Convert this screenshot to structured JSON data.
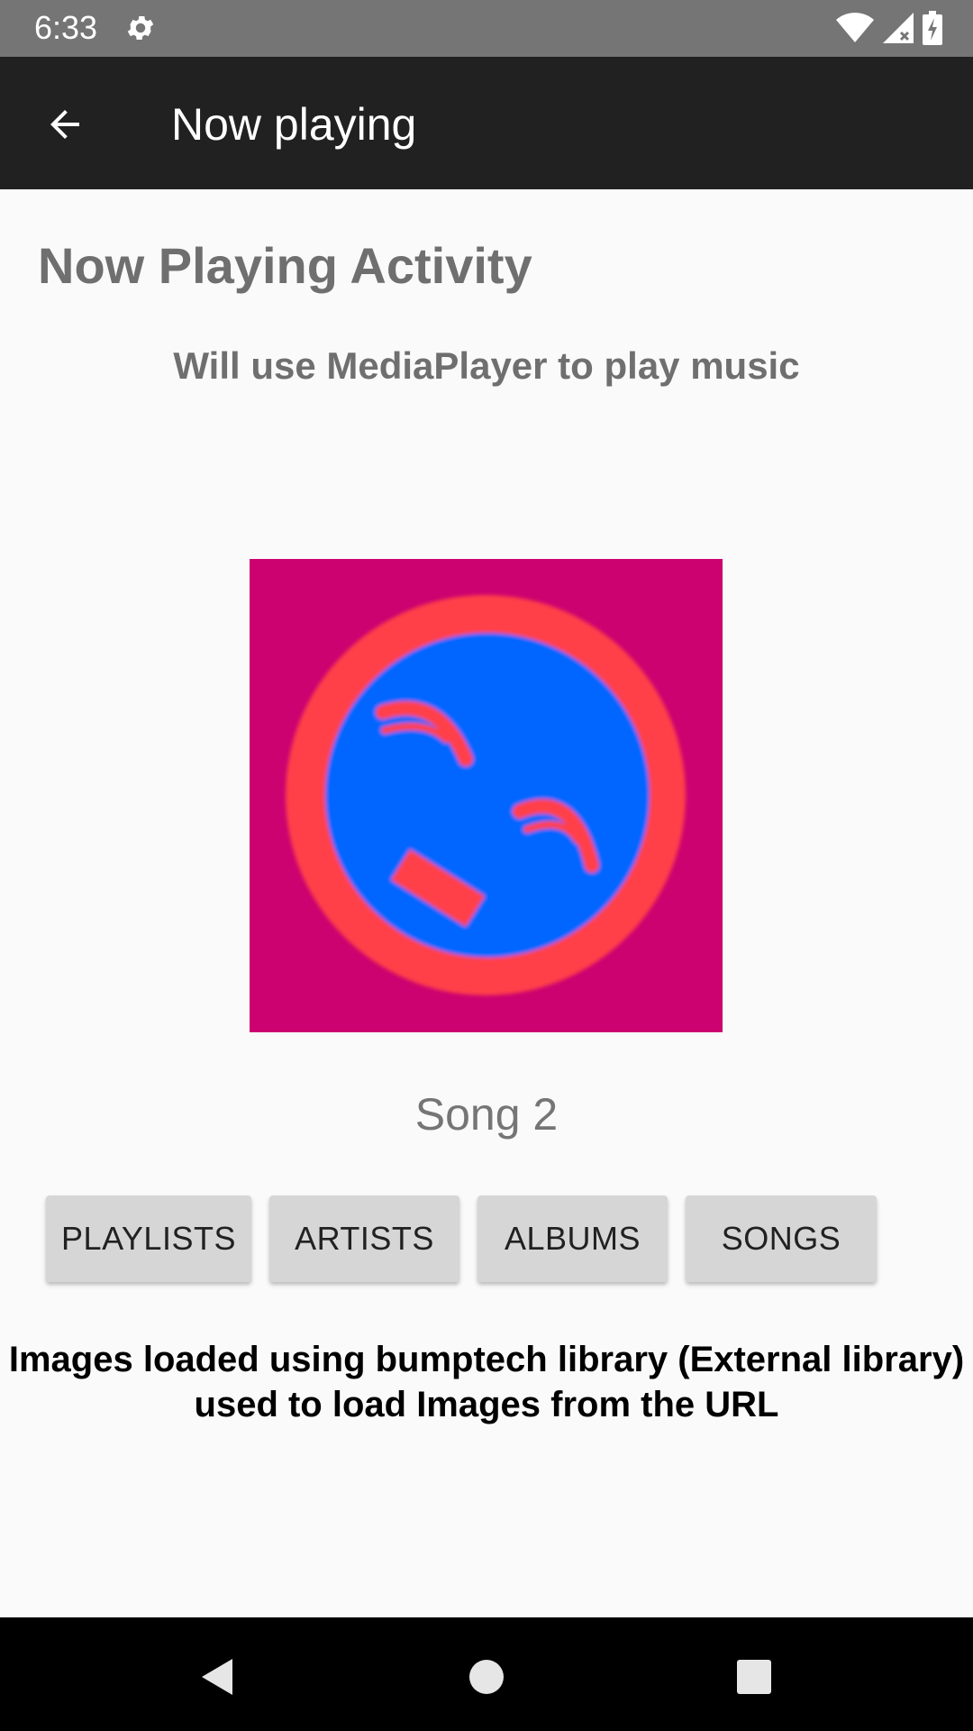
{
  "status_bar": {
    "time": "6:33",
    "icons": [
      "gear-icon",
      "wifi-icon",
      "signal-icon",
      "battery-icon"
    ]
  },
  "app_bar": {
    "back_icon": "arrow-back-icon",
    "title": "Now playing"
  },
  "content": {
    "heading": "Now Playing Activity",
    "subheading": "Will use MediaPlayer to play music",
    "album_art": {
      "background_color": "#cc0270",
      "ring_color": "#ff4048",
      "face_color": "#0066ff"
    },
    "song_title": "Song 2",
    "buttons": [
      {
        "label": "PLAYLISTS"
      },
      {
        "label": "ARTISTS"
      },
      {
        "label": "ALBUMS"
      },
      {
        "label": "SONGS"
      }
    ],
    "footer_line1": "Images loaded using bumptech library (External library)",
    "footer_line2": "used to load Images from the URL"
  },
  "nav_bar": {
    "icons": [
      "nav-back-icon",
      "nav-home-icon",
      "nav-recents-icon"
    ]
  },
  "colors": {
    "status_bar": "#757575",
    "app_bar": "#212121",
    "background": "#fafafa",
    "button": "#d6d6d6"
  }
}
